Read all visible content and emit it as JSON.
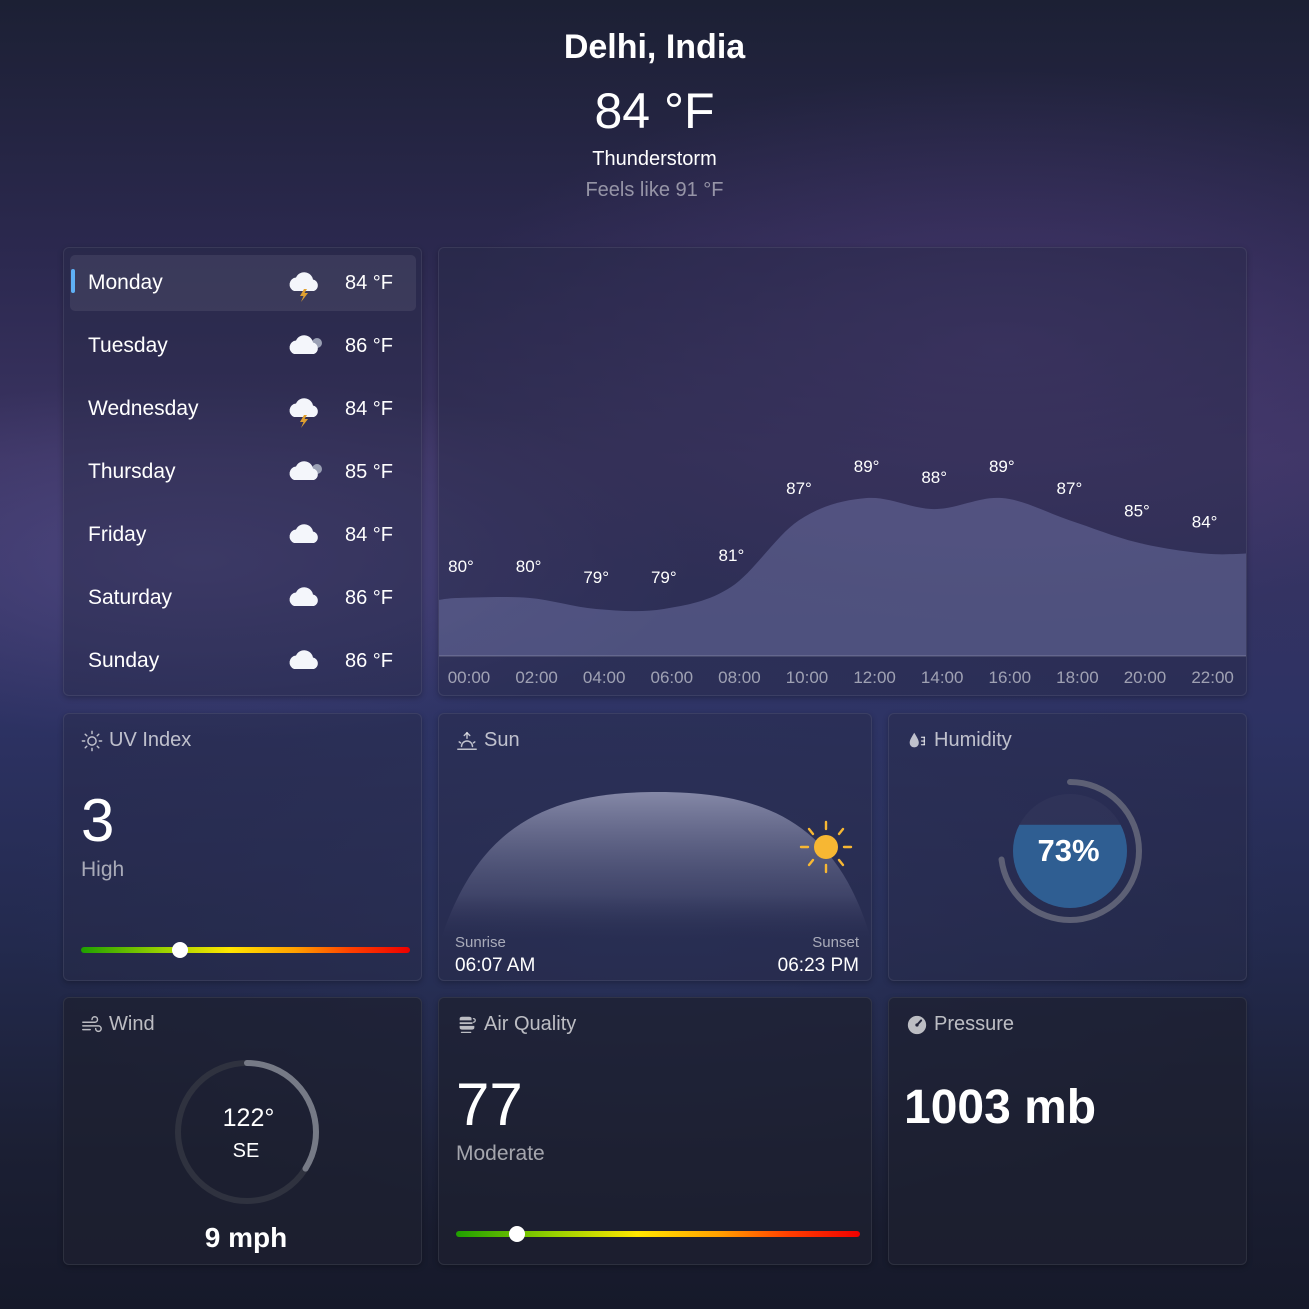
{
  "location": "Delhi, India",
  "current": {
    "temperature": "84 °F",
    "condition": "Thunderstorm",
    "feels_like": "Feels like 91 °F"
  },
  "forecast": [
    {
      "day": "Monday",
      "icon": "thunderstorm-icon",
      "temp": "84 °F",
      "selected": true
    },
    {
      "day": "Tuesday",
      "icon": "partly-cloudy-icon",
      "temp": "86 °F",
      "selected": false
    },
    {
      "day": "Wednesday",
      "icon": "thunderstorm-icon",
      "temp": "84 °F",
      "selected": false
    },
    {
      "day": "Thursday",
      "icon": "partly-cloudy-icon",
      "temp": "85 °F",
      "selected": false
    },
    {
      "day": "Friday",
      "icon": "cloud-icon",
      "temp": "84 °F",
      "selected": false
    },
    {
      "day": "Saturday",
      "icon": "cloud-icon",
      "temp": "86 °F",
      "selected": false
    },
    {
      "day": "Sunday",
      "icon": "cloud-icon",
      "temp": "86 °F",
      "selected": false
    }
  ],
  "chart_data": {
    "type": "area",
    "x": [
      "00:00",
      "02:00",
      "04:00",
      "06:00",
      "08:00",
      "10:00",
      "12:00",
      "14:00",
      "16:00",
      "18:00",
      "20:00",
      "22:00"
    ],
    "values": [
      80,
      80,
      79,
      79,
      81,
      87,
      89,
      88,
      89,
      87,
      85,
      84
    ],
    "value_labels": [
      "80°",
      "80°",
      "79°",
      "79°",
      "81°",
      "87°",
      "89°",
      "88°",
      "89°",
      "87°",
      "85°",
      "84°"
    ],
    "grid": false
  },
  "uv": {
    "title": "UV Index",
    "value": "3",
    "level": "High",
    "scale_position": 0.3
  },
  "sun": {
    "title": "Sun",
    "sunrise_label": "Sunrise",
    "sunrise": "06:07 AM",
    "sunset_label": "Sunset",
    "sunset": "06:23 PM"
  },
  "humidity": {
    "title": "Humidity",
    "value": "73%",
    "fraction": 0.73
  },
  "wind": {
    "title": "Wind",
    "direction_degrees": "122°",
    "direction": "SE",
    "speed": "9 mph",
    "heading": 122
  },
  "air_quality": {
    "title": "Air Quality",
    "value": "77",
    "level": "Moderate",
    "scale_position": 0.15
  },
  "pressure": {
    "title": "Pressure",
    "value": "1003 mb"
  },
  "colors": {
    "accent": "#5fb0f5",
    "sun": "#f7b733",
    "humidity_fill": "#2f5e92"
  }
}
